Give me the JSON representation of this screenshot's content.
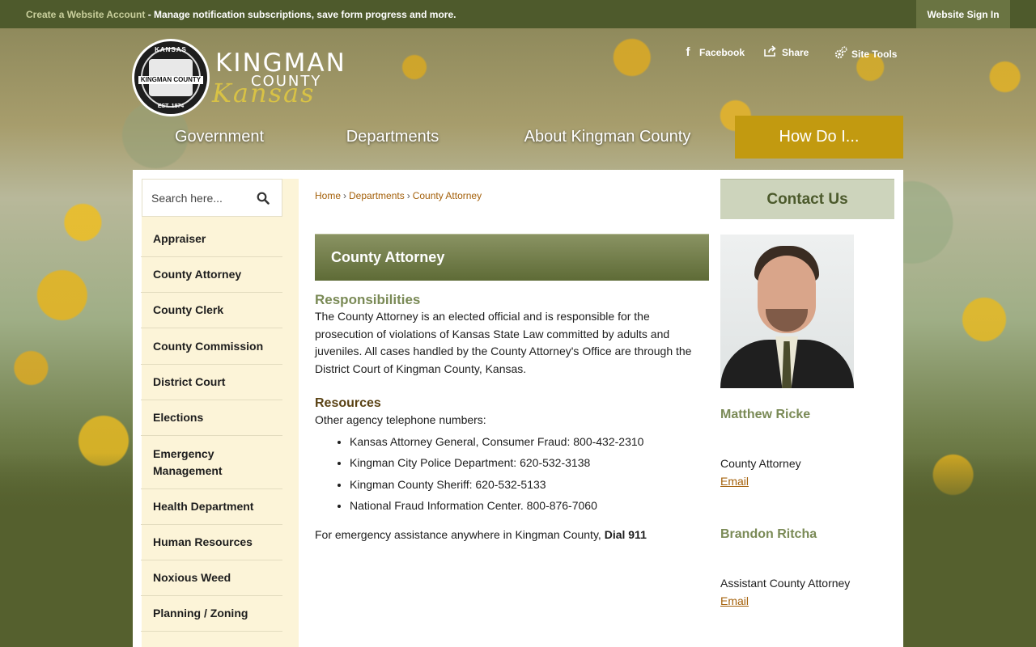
{
  "topbar": {
    "account_link": "Create a Website Account",
    "message": " - Manage notification subscriptions, save form progress and more.",
    "signin": "Website Sign In"
  },
  "logo": {
    "seal_top": "KANSAS",
    "seal_name": "KINGMAN COUNTY",
    "seal_est": "EST. 1874",
    "word_kingman": "KINGMAN",
    "word_county": "COUNTY",
    "word_kansas": "Kansas"
  },
  "social": {
    "facebook": "Facebook",
    "share": "Share",
    "site_tools": "Site Tools"
  },
  "mainnav": {
    "items": [
      "Government",
      "Departments",
      "About Kingman County",
      "How Do I..."
    ]
  },
  "sidebar": {
    "search_placeholder": "Search here...",
    "items": [
      "Appraiser",
      "County Attorney",
      "County Clerk",
      "County Commission",
      "District Court",
      "Elections",
      "Emergency Management",
      "Health Department",
      "Human Resources",
      "Noxious Weed",
      "Planning / Zoning"
    ]
  },
  "breadcrumb": {
    "items": [
      "Home",
      "Departments",
      "County Attorney"
    ],
    "separator": "›"
  },
  "page": {
    "title": "County Attorney",
    "responsibilities_heading": "Responsibilities",
    "responsibilities_text": "The County Attorney is an elected official and is responsible for the prosecution of violations of Kansas State Law committed by adults and juveniles. All cases handled by the County Attorney's Office are through the District Court of Kingman County, Kansas.",
    "resources_heading": "Resources",
    "resources_intro": "Other agency telephone numbers:",
    "resources_list": [
      "Kansas Attorney General, Consumer Fraud: 800-432-2310",
      "Kingman City Police Department: 620-532-3138",
      "Kingman County Sheriff: 620-532-5133",
      "National Fraud Information Center. 800-876-7060"
    ],
    "emergency_text": "For emergency assistance anywhere in Kingman County, ",
    "emergency_bold": "Dial 911"
  },
  "contact": {
    "button": "Contact Us",
    "people": [
      {
        "name": "Matthew Ricke",
        "title": "County Attorney",
        "email_label": "Email"
      },
      {
        "name": "Brandon Ritcha",
        "title": "Assistant County Attorney",
        "email_label": "Email"
      }
    ]
  },
  "colors": {
    "olive_dark": "#4e5a2c",
    "olive_header": "#5e6b36",
    "gold_accent": "#c29a10",
    "link_orange": "#a4600a",
    "sidebar_bg": "#fcf4d8",
    "contact_bg": "#cdd4bc"
  },
  "icons": [
    "facebook-icon",
    "share-icon",
    "gear-icon",
    "search-icon"
  ]
}
